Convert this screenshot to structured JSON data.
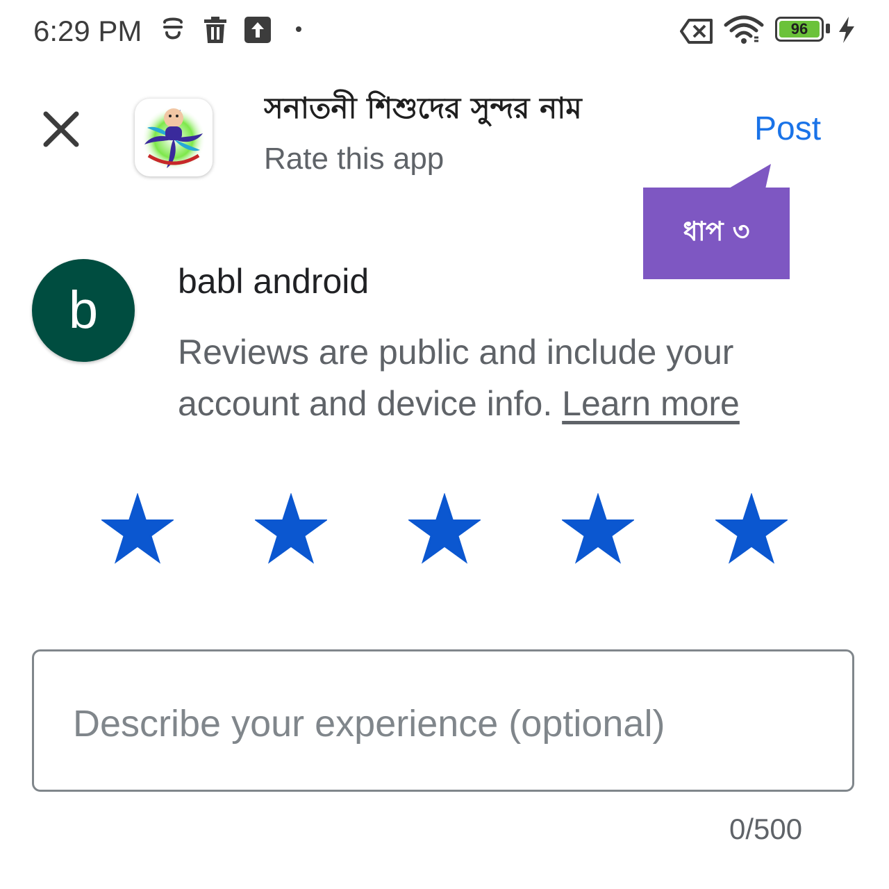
{
  "status_bar": {
    "time": "6:29 PM",
    "icons": [
      "gesture-icon",
      "trash-icon",
      "upload-icon",
      "dot-icon",
      "no-sim-icon",
      "wifi-icon",
      "battery-icon",
      "charging-icon"
    ],
    "battery_level": "96"
  },
  "header": {
    "app_name": "সনাতনী শিশুদের সুন্দর নাম",
    "subtitle": "Rate this app",
    "post_label": "Post",
    "close_icon": "close-icon",
    "app_icon": "app-logo-icon"
  },
  "callout": {
    "label": "ধাপ ৩",
    "color": "#7e57c2"
  },
  "user": {
    "avatar_letter": "b",
    "avatar_color": "#004d40",
    "name": "babl android",
    "disclaimer": "Reviews are public and include your account and device info.",
    "learn_more": "Learn more"
  },
  "rating": {
    "stars_total": 5,
    "stars_selected": 5,
    "star_color": "#0b57d0"
  },
  "review": {
    "placeholder": "Describe your experience (optional)",
    "value": "",
    "char_count": "0/500"
  },
  "colors": {
    "accent": "#1a73e8",
    "text_secondary": "#5f6368"
  }
}
